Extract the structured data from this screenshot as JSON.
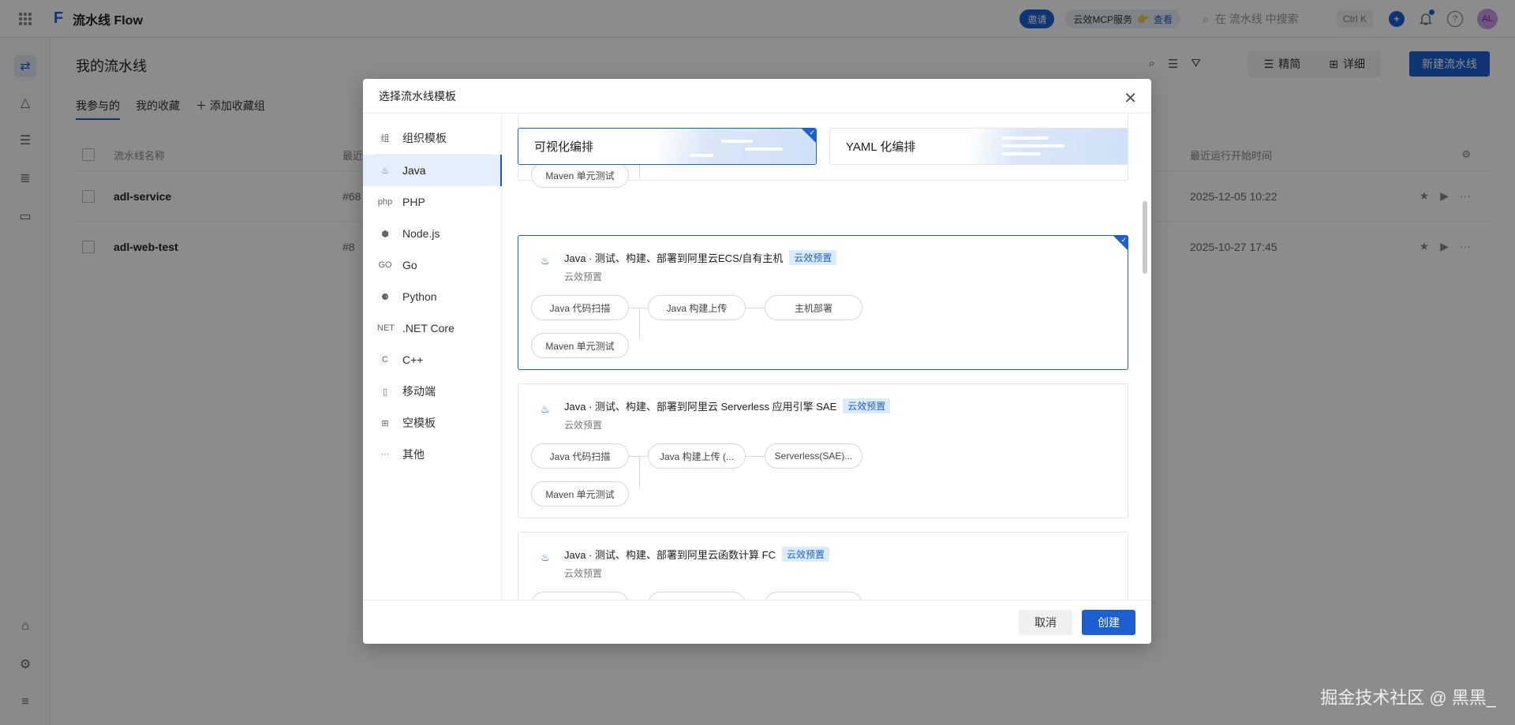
{
  "topbar": {
    "app_title": "流水线 Flow",
    "invite_label": "邀请",
    "mcp_label": "云效MCP服务",
    "mcp_view": "查看",
    "search_placeholder": "在 流水线 中搜索",
    "shortcut": "Ctrl K",
    "avatar": "AL"
  },
  "page": {
    "title": "我的流水线",
    "tabs": [
      "我参与的",
      "我的收藏"
    ],
    "add_group": "添加收藏组",
    "view_simple": "精简",
    "view_detail": "详细",
    "new_button": "新建流水线",
    "columns": [
      "流水线名称",
      "最近",
      "最近运行开始时间"
    ],
    "rows": [
      {
        "name": "adl-service",
        "num": "#68",
        "time": "2025-12-05 10:22"
      },
      {
        "name": "adl-web-test",
        "num": "#8",
        "time": "2025-10-27 17:45"
      }
    ]
  },
  "modal": {
    "title": "选择流水线模板",
    "categories": [
      {
        "icon": "组",
        "label": "组织模板"
      },
      {
        "icon": "♨",
        "label": "Java"
      },
      {
        "icon": "php",
        "label": "PHP"
      },
      {
        "icon": "⬢",
        "label": "Node.js"
      },
      {
        "icon": "GO",
        "label": "Go"
      },
      {
        "icon": "⚈",
        "label": "Python"
      },
      {
        "icon": "NET",
        "label": ".NET Core"
      },
      {
        "icon": "C",
        "label": "C++"
      },
      {
        "icon": "▯",
        "label": "移动端"
      },
      {
        "icon": "⊞",
        "label": "空模板"
      },
      {
        "icon": "···",
        "label": "其他"
      }
    ],
    "mode_visual": "可视化编排",
    "mode_yaml": "YAML 化编排",
    "partial_stage": "Maven 单元测试",
    "cards": [
      {
        "title": "Java · 测试、构建、部署到阿里云ECS/自有主机",
        "badge": "云效预置",
        "sub": "云效预置",
        "stages": [
          "Java 代码扫描",
          "Java 构建上传",
          "主机部署",
          "Maven 单元测试"
        ]
      },
      {
        "title": "Java · 测试、构建、部署到阿里云 Serverless 应用引擎 SAE",
        "badge": "云效预置",
        "sub": "云效预置",
        "stages": [
          "Java 代码扫描",
          "Java 构建上传 (...",
          "Serverless(SAE)...",
          "Maven 单元测试"
        ]
      },
      {
        "title": "Java · 测试、构建、部署到阿里云函数计算 FC",
        "badge": "云效预置",
        "sub": "云效预置",
        "stages": [
          "",
          "",
          ""
        ]
      }
    ],
    "cancel": "取消",
    "create": "创建"
  },
  "watermark": "掘金技术社区 @ 黑黑_"
}
